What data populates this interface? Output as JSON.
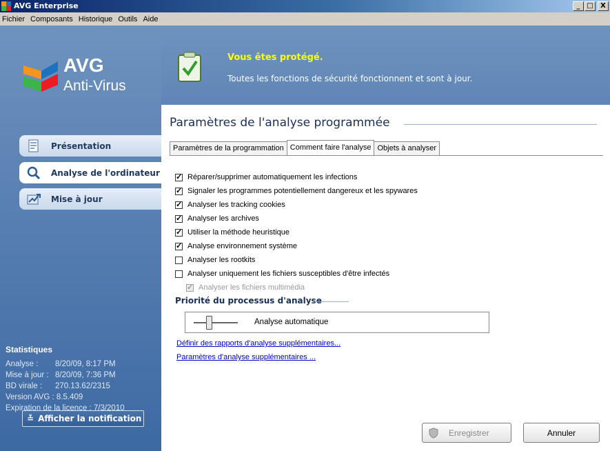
{
  "window": {
    "title": "AVG Enterprise",
    "controls": [
      "_",
      "□",
      "X"
    ]
  },
  "menu": [
    {
      "label": "Fichier"
    },
    {
      "label": "Composants"
    },
    {
      "label": "Historique"
    },
    {
      "label": "Outils"
    },
    {
      "label": "Aide"
    }
  ],
  "logo": {
    "brand": "AVG",
    "product": "Anti-Virus"
  },
  "status": {
    "title": "Vous êtes protégé.",
    "text": "Toutes les fonctions de sécurité fonctionnent et sont à jour."
  },
  "nav": [
    {
      "label": "Présentation",
      "icon": "document-icon",
      "active": false
    },
    {
      "label": "Analyse de l'ordinateur",
      "icon": "magnifier-icon",
      "active": true
    },
    {
      "label": "Mise à jour",
      "icon": "update-icon",
      "active": false
    }
  ],
  "stats": {
    "title": "Statistiques",
    "rows": [
      {
        "k": "Analyse :",
        "v": "8/20/09, 8:17 PM"
      },
      {
        "k": "Mise à jour :",
        "v": "8/20/09, 7:36 PM"
      },
      {
        "k": "BD virale :",
        "v": "270.13.62/2315"
      }
    ],
    "version": "Version AVG : 8.5.409",
    "license": "Expiration de la licence : 7/3/2010"
  },
  "notification_button": "Afficher la notification",
  "page": {
    "title": "Paramètres de l'analyse programmée",
    "tabs": [
      {
        "label": "Paramètres de la programmation",
        "selected": false
      },
      {
        "label": "Comment faire l'analyse",
        "selected": true
      },
      {
        "label": "Objets à analyser",
        "selected": false
      }
    ],
    "checkboxes": [
      {
        "label": "Réparer/supprimer automatiquement les infections",
        "checked": true
      },
      {
        "label": "Signaler les programmes potentiellement dangereux et les spywares",
        "checked": true
      },
      {
        "label": "Analyser les tracking cookies",
        "checked": true
      },
      {
        "label": "Analyser les archives",
        "checked": true
      },
      {
        "label": "Utiliser la méthode heuristique",
        "checked": true
      },
      {
        "label": "Analyse environnement système",
        "checked": true
      },
      {
        "label": "Analyser les rootkits",
        "checked": false
      },
      {
        "label": "Analyser uniquement les fichiers susceptibles d'être infectés",
        "checked": false
      }
    ],
    "sub_checkbox": {
      "label": "Analyser les fichiers multimédia",
      "checked": true,
      "disabled": true
    },
    "priority": {
      "title": "Priorité du processus d'analyse",
      "value_label": "Analyse automatique",
      "level": 0.5
    },
    "links": [
      "Définir des rapports d'analyse supplémentaires...",
      "Paramètres d'analyse supplémentaires ..."
    ],
    "buttons": {
      "save": "Enregistrer",
      "cancel": "Annuler"
    }
  }
}
